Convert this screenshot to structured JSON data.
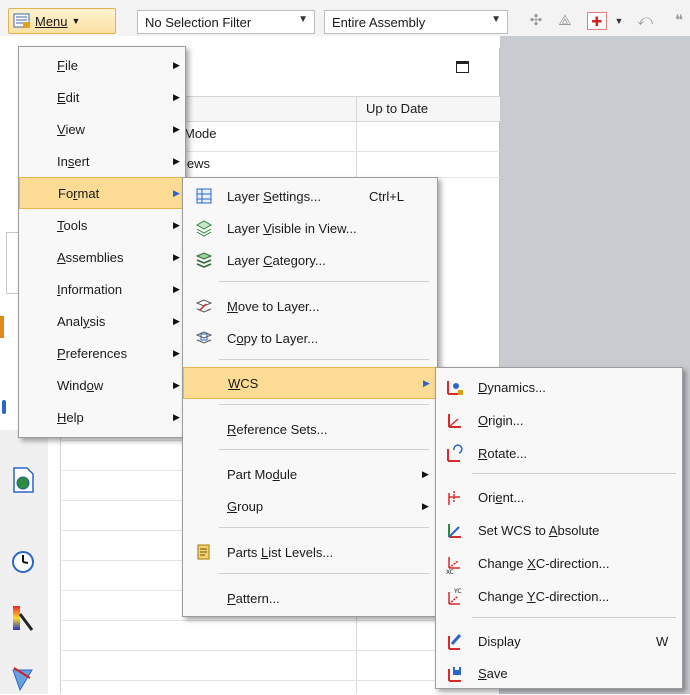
{
  "toolbar": {
    "menu_label": "Menu",
    "selection_filter": "No Selection Filter",
    "scope": "Entire Assembly"
  },
  "navigator": {
    "column_header": "Up to Date",
    "rows": [
      "Mode",
      "iews"
    ]
  },
  "main_menu": [
    {
      "key": "F",
      "rest": "ile"
    },
    {
      "key": "E",
      "rest": "dit"
    },
    {
      "key": "V",
      "rest": "iew"
    },
    {
      "pre": "In",
      "key": "s",
      "rest": "ert"
    },
    {
      "pre": "Fo",
      "key": "r",
      "rest": "mat"
    },
    {
      "key": "T",
      "rest": "ools"
    },
    {
      "key": "A",
      "rest": "ssemblies"
    },
    {
      "key": "I",
      "rest": "nformation"
    },
    {
      "pre": "Anal",
      "key": "y",
      "rest": "sis"
    },
    {
      "key": "P",
      "rest": "references"
    },
    {
      "pre": "Wind",
      "key": "o",
      "rest": "w"
    },
    {
      "key": "H",
      "rest": "elp"
    }
  ],
  "format_menu": {
    "layer_settings": {
      "pre": "Layer ",
      "key": "S",
      "rest": "ettings...",
      "shortcut": "Ctrl+L"
    },
    "layer_visible": {
      "pre": "Layer ",
      "key": "V",
      "rest": "isible in View..."
    },
    "layer_category": {
      "pre": "Layer ",
      "key": "C",
      "rest": "ategory..."
    },
    "move_to_layer": {
      "key": "M",
      "rest": "ove to Layer..."
    },
    "copy_to_layer": {
      "pre": "C",
      "key": "o",
      "rest": "py to Layer..."
    },
    "wcs": {
      "key": "W",
      "rest": "CS"
    },
    "reference_sets": {
      "key": "R",
      "rest": "eference Sets..."
    },
    "part_module": {
      "pre": "Part Mo",
      "key": "d",
      "rest": "ule"
    },
    "group": {
      "key": "G",
      "rest": "roup"
    },
    "parts_list_levels": {
      "pre": "Parts ",
      "key": "L",
      "rest": "ist Levels..."
    },
    "pattern": {
      "key": "P",
      "rest": "attern..."
    }
  },
  "wcs_menu": {
    "dynamics": {
      "key": "D",
      "rest": "ynamics..."
    },
    "origin": {
      "key": "O",
      "rest": "rigin..."
    },
    "rotate": {
      "key": "R",
      "rest": "otate..."
    },
    "orient": {
      "pre": "Ori",
      "key": "e",
      "rest": "nt..."
    },
    "set_absolute": {
      "pre": "Set WCS to ",
      "key": "A",
      "rest": "bsolute"
    },
    "change_xc": {
      "pre": "Change ",
      "key": "X",
      "rest": "C-direction..."
    },
    "change_yc": {
      "pre": "Change ",
      "key": "Y",
      "rest": "C-direction..."
    },
    "display": {
      "pre": "Display",
      "shortcut": "W"
    },
    "save": {
      "key": "S",
      "rest": "ave"
    }
  },
  "icons": {
    "accent_red": "#d62b2b",
    "accent_blue": "#2a66c8",
    "accent_green": "#2e8b3e",
    "accent_gold": "#d8a016"
  }
}
